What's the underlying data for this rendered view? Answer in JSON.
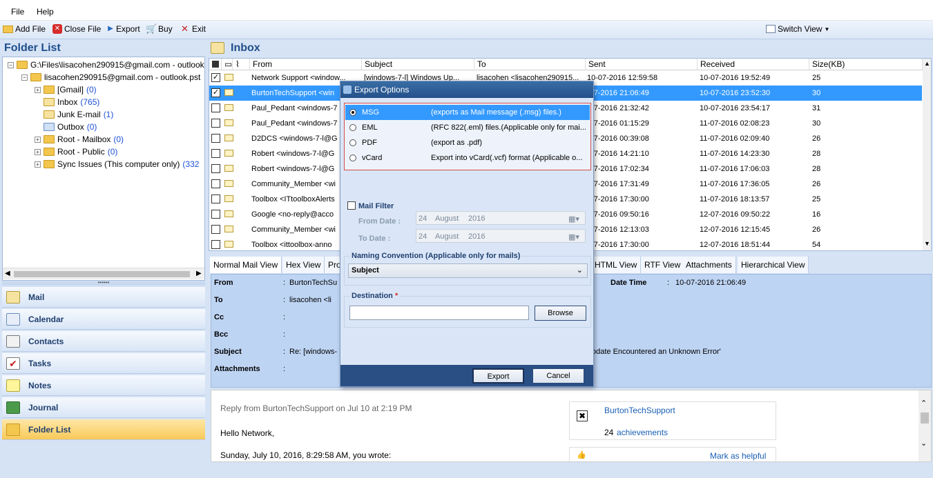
{
  "menu": [
    "File",
    "Help"
  ],
  "toolbar": {
    "add_file": "Add File",
    "close_file": "Close File",
    "export": "Export",
    "buy": "Buy",
    "exit": "Exit",
    "switch_view": "Switch View"
  },
  "folder_list": {
    "title": "Folder List",
    "root_path": "G:\\Files\\lisacohen290915@gmail.com - outlook",
    "account": "lisacohen290915@gmail.com - outlook.pst",
    "items": [
      {
        "label": "[Gmail]",
        "count": "(0)"
      },
      {
        "label": "Inbox",
        "count": "(765)"
      },
      {
        "label": "Junk E-mail",
        "count": "(1)"
      },
      {
        "label": "Outbox",
        "count": "(0)"
      },
      {
        "label": "Root - Mailbox",
        "count": "(0)"
      },
      {
        "label": "Root - Public",
        "count": "(0)"
      },
      {
        "label": "Sync Issues (This computer only)",
        "count": "(332"
      }
    ]
  },
  "nav": [
    "Mail",
    "Calendar",
    "Contacts",
    "Tasks",
    "Notes",
    "Journal",
    "Folder List"
  ],
  "inbox": {
    "title": "Inbox",
    "columns": [
      "From",
      "Subject",
      "To",
      "Sent",
      "Received",
      "Size(KB)"
    ],
    "rows": [
      {
        "from": "Network Support <window...",
        "subject": "[windows-7-l] Windows Up...",
        "to": "lisacohen <lisacohen290915...",
        "sent": "10-07-2016 12:59:58",
        "received": "10-07-2016 19:52:49",
        "size": "25",
        "checked": true
      },
      {
        "from": "BurtonTechSupport <win",
        "subject": "",
        "to": "",
        "sent": "-07-2016 21:06:49",
        "received": "10-07-2016 23:52:30",
        "size": "30",
        "checked": true
      },
      {
        "from": "Paul_Pedant <windows-7",
        "subject": "",
        "to": "",
        "sent": "-07-2016 21:32:42",
        "received": "10-07-2016 23:54:17",
        "size": "31",
        "checked": false
      },
      {
        "from": "Paul_Pedant <windows-7",
        "subject": "",
        "to": "",
        "sent": "-07-2016 01:15:29",
        "received": "11-07-2016 02:08:23",
        "size": "30",
        "checked": false
      },
      {
        "from": "D2DCS <windows-7-l@G",
        "subject": "",
        "to": "",
        "sent": "-07-2016 00:39:08",
        "received": "11-07-2016 02:09:40",
        "size": "26",
        "checked": false
      },
      {
        "from": "Robert <windows-7-l@G",
        "subject": "",
        "to": "",
        "sent": "-07-2016 14:21:10",
        "received": "11-07-2016 14:23:30",
        "size": "28",
        "checked": false
      },
      {
        "from": "Robert <windows-7-l@G",
        "subject": "",
        "to": "",
        "sent": "-07-2016 17:02:34",
        "received": "11-07-2016 17:06:03",
        "size": "28",
        "checked": false
      },
      {
        "from": "Community_Member <wi",
        "subject": "",
        "to": "",
        "sent": "-07-2016 17:31:49",
        "received": "11-07-2016 17:36:05",
        "size": "26",
        "checked": false
      },
      {
        "from": "Toolbox <ITtoolboxAlerts",
        "subject": "",
        "to": "",
        "sent": "-07-2016 17:30:00",
        "received": "11-07-2016 18:13:57",
        "size": "25",
        "checked": false
      },
      {
        "from": "Google <no-reply@acco",
        "subject": "",
        "to": "",
        "sent": "-07-2016 09:50:16",
        "received": "12-07-2016 09:50:22",
        "size": "16",
        "checked": false
      },
      {
        "from": "Community_Member <wi",
        "subject": "",
        "to": "",
        "sent": "-07-2016 12:13:03",
        "received": "12-07-2016 12:15:45",
        "size": "26",
        "checked": false
      },
      {
        "from": "Toolbox <ittoolbox-anno",
        "subject": "",
        "to": "",
        "sent": "-07-2016 17:30:00",
        "received": "12-07-2016 18:51:44",
        "size": "54",
        "checked": false
      }
    ]
  },
  "tabs": [
    "Normal Mail View",
    "Hex View",
    "Pro",
    "HTML View",
    "RTF View",
    "Attachments",
    "Hierarchical View"
  ],
  "details": {
    "from_label": "From",
    "from_value": "BurtonTechSu",
    "to_label": "To",
    "to_value": "lisacohen <li",
    "cc_label": "Cc",
    "bcc_label": "Bcc",
    "subject_label": "Subject",
    "subject_value": "Re: [windows-",
    "subject_tail": "odate Encountered an Unknown Error'",
    "attachments_label": "Attachments",
    "datetime_label": "Date Time",
    "datetime_value": "10-07-2016 21:06:49",
    "colon": ":"
  },
  "preview": {
    "reply_line": "Reply from BurtonTechSupport on Jul 10 at 2:19 PM",
    "greeting": "Hello Network,",
    "date_line": "Sunday, July 10, 2016, 8:29:58 AM, you wrote:",
    "author": "BurtonTechSupport",
    "achievements_count": "24",
    "achievements": "achievements",
    "helpful": "Mark as helpful"
  },
  "dialog": {
    "title": "Export Options",
    "formats": [
      {
        "name": "MSG",
        "desc": "(exports as Mail message (.msg) files.)"
      },
      {
        "name": "EML",
        "desc": "(RFC 822(.eml) files.(Applicable only for mai..."
      },
      {
        "name": "PDF",
        "desc": "(export as .pdf)"
      },
      {
        "name": "vCard",
        "desc": "Export into vCard(.vcf) format (Applicable o..."
      }
    ],
    "mail_filter": "Mail Filter",
    "from_date_label": "From Date :",
    "to_date_label": "To Date :",
    "from_date": {
      "day": "24",
      "month": "August",
      "year": "2016"
    },
    "to_date": {
      "day": "24",
      "month": "August",
      "year": "2016"
    },
    "naming_label": "Naming Convention (Applicable only for mails)",
    "naming_value": "Subject",
    "destination_label": "Destination",
    "required_mark": "*",
    "browse": "Browse",
    "export": "Export",
    "cancel": "Cancel"
  }
}
